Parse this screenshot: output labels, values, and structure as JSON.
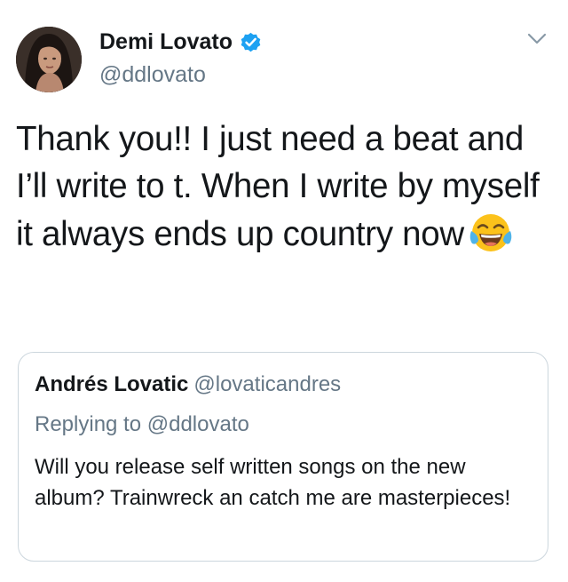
{
  "tweet": {
    "author_name": "Demi Lovato",
    "handle": "@ddlovato",
    "verified": true,
    "avatar_icon": "profile-photo",
    "menu_icon": "chevron-down-icon",
    "text": "Thank you!! I just need a beat and I’ll write to t. When I write by myself it always ends up country now",
    "emoji": "face-with-tears-of-joy-emoji"
  },
  "quoted_tweet": {
    "author_name": "Andrés Lovatic",
    "handle": "@lovaticandres",
    "replying_to": "Replying to @ddlovato",
    "text": "Will you release self written songs on the new album? Trainwreck an catch me are masterpieces!"
  },
  "colors": {
    "verified_blue": "#1da1f2",
    "secondary_text": "#657786",
    "border": "#ccd6dd",
    "text": "#14171a"
  }
}
